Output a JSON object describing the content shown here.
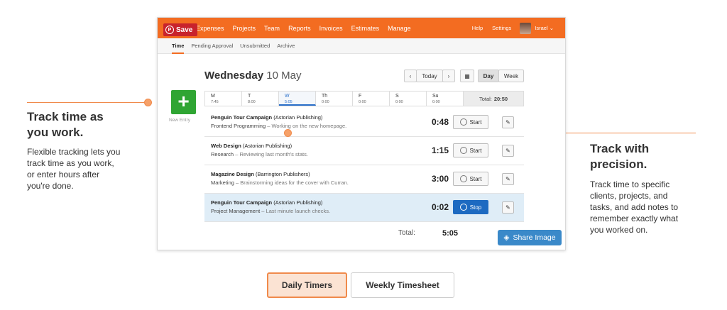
{
  "annotations": {
    "left_title": "Track time as\nyou work.",
    "left_body": "Flexible tracking lets you\ntrack time as you work,\nor enter hours after\nyou're done.",
    "right_title": "Track with\nprecision.",
    "right_body": "Track time to specific\nclients, projects, and\ntasks, and add notes to\nremember exactly what\nyou worked on."
  },
  "topbar": {
    "save_label": "Save",
    "nav": [
      "Expenses",
      "Projects",
      "Team",
      "Reports",
      "Invoices",
      "Estimates",
      "Manage"
    ],
    "help": "Help",
    "settings": "Settings",
    "user": "Israel ⌄"
  },
  "subnav": [
    "Time",
    "Pending Approval",
    "Unsubmitted",
    "Archive"
  ],
  "new_entry_label": "New Entry",
  "day": {
    "weekday": "Wednesday",
    "date": "10 May"
  },
  "controls": {
    "prev": "‹",
    "today": "Today",
    "next": "›",
    "calendar": "▦",
    "day": "Day",
    "week": "Week"
  },
  "week": [
    {
      "d": "M",
      "h": "7:45"
    },
    {
      "d": "T",
      "h": "8:00"
    },
    {
      "d": "W",
      "h": "5:05"
    },
    {
      "d": "Th",
      "h": "0:00"
    },
    {
      "d": "F",
      "h": "0:00"
    },
    {
      "d": "S",
      "h": "0:00"
    },
    {
      "d": "Su",
      "h": "0:00"
    }
  ],
  "week_total_label": "Total:",
  "week_total_value": "20:50",
  "entries": [
    {
      "project": "Penguin Tour Campaign",
      "client": "(Astorian Publishing)",
      "task": "Frontend Programming",
      "note": "Working on the new homepage.",
      "duration": "0:48",
      "action": "Start"
    },
    {
      "project": "Web Design",
      "client": "(Astorian Publishing)",
      "task": "Research",
      "note": "Reviewing last month's stats.",
      "duration": "1:15",
      "action": "Start"
    },
    {
      "project": "Magazine Design",
      "client": "(Barrington Publishers)",
      "task": "Marketing",
      "note": "Brainstorming ideas for the cover with Curran.",
      "duration": "3:00",
      "action": "Start"
    },
    {
      "project": "Penguin Tour Campaign",
      "client": "(Astorian Publishing)",
      "task": "Project Management",
      "note": "Last minute launch checks.",
      "duration": "0:02",
      "action": "Stop"
    }
  ],
  "task_sep": "–",
  "total_label": "Total:",
  "total_value": "5:05",
  "share_label": "Share Image",
  "tabs": [
    "Daily Timers",
    "Weekly Timesheet"
  ],
  "colors": {
    "accent": "#f36c21",
    "new_entry": "#2fa533",
    "stop": "#1d6ac1",
    "annotation": "#f08a4b"
  }
}
